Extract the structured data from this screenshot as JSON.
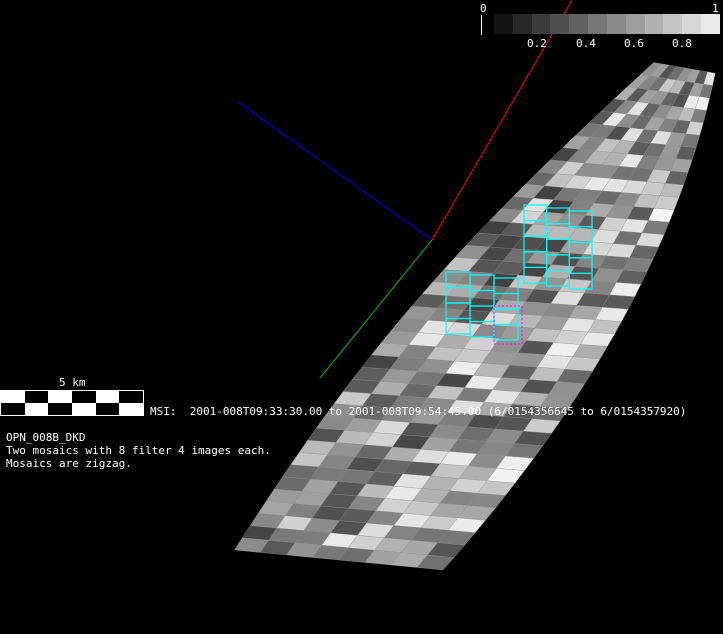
{
  "colorbar": {
    "min_label": "0",
    "tick_labels": [
      "0.2",
      "0.4",
      "0.6",
      "0.8"
    ],
    "max_label": "1"
  },
  "scale_bar": {
    "label": "5 km"
  },
  "msi_label": "MSI:  2001-008T09:33:30.00 to 2001-008T09:54:45.00 (6/0154356645 to 6/0154357920)",
  "notes": [
    "OPN_008B_DKD",
    "Two mosaics with 8 filter 4 images each.",
    "Mosaics are zigzag."
  ],
  "colors": {
    "x_axis": "#ff0000",
    "y_axis": "#00c000",
    "z_axis": "#0000ff",
    "footprints": "#00ffff",
    "highlight": "#ff00ff"
  }
}
